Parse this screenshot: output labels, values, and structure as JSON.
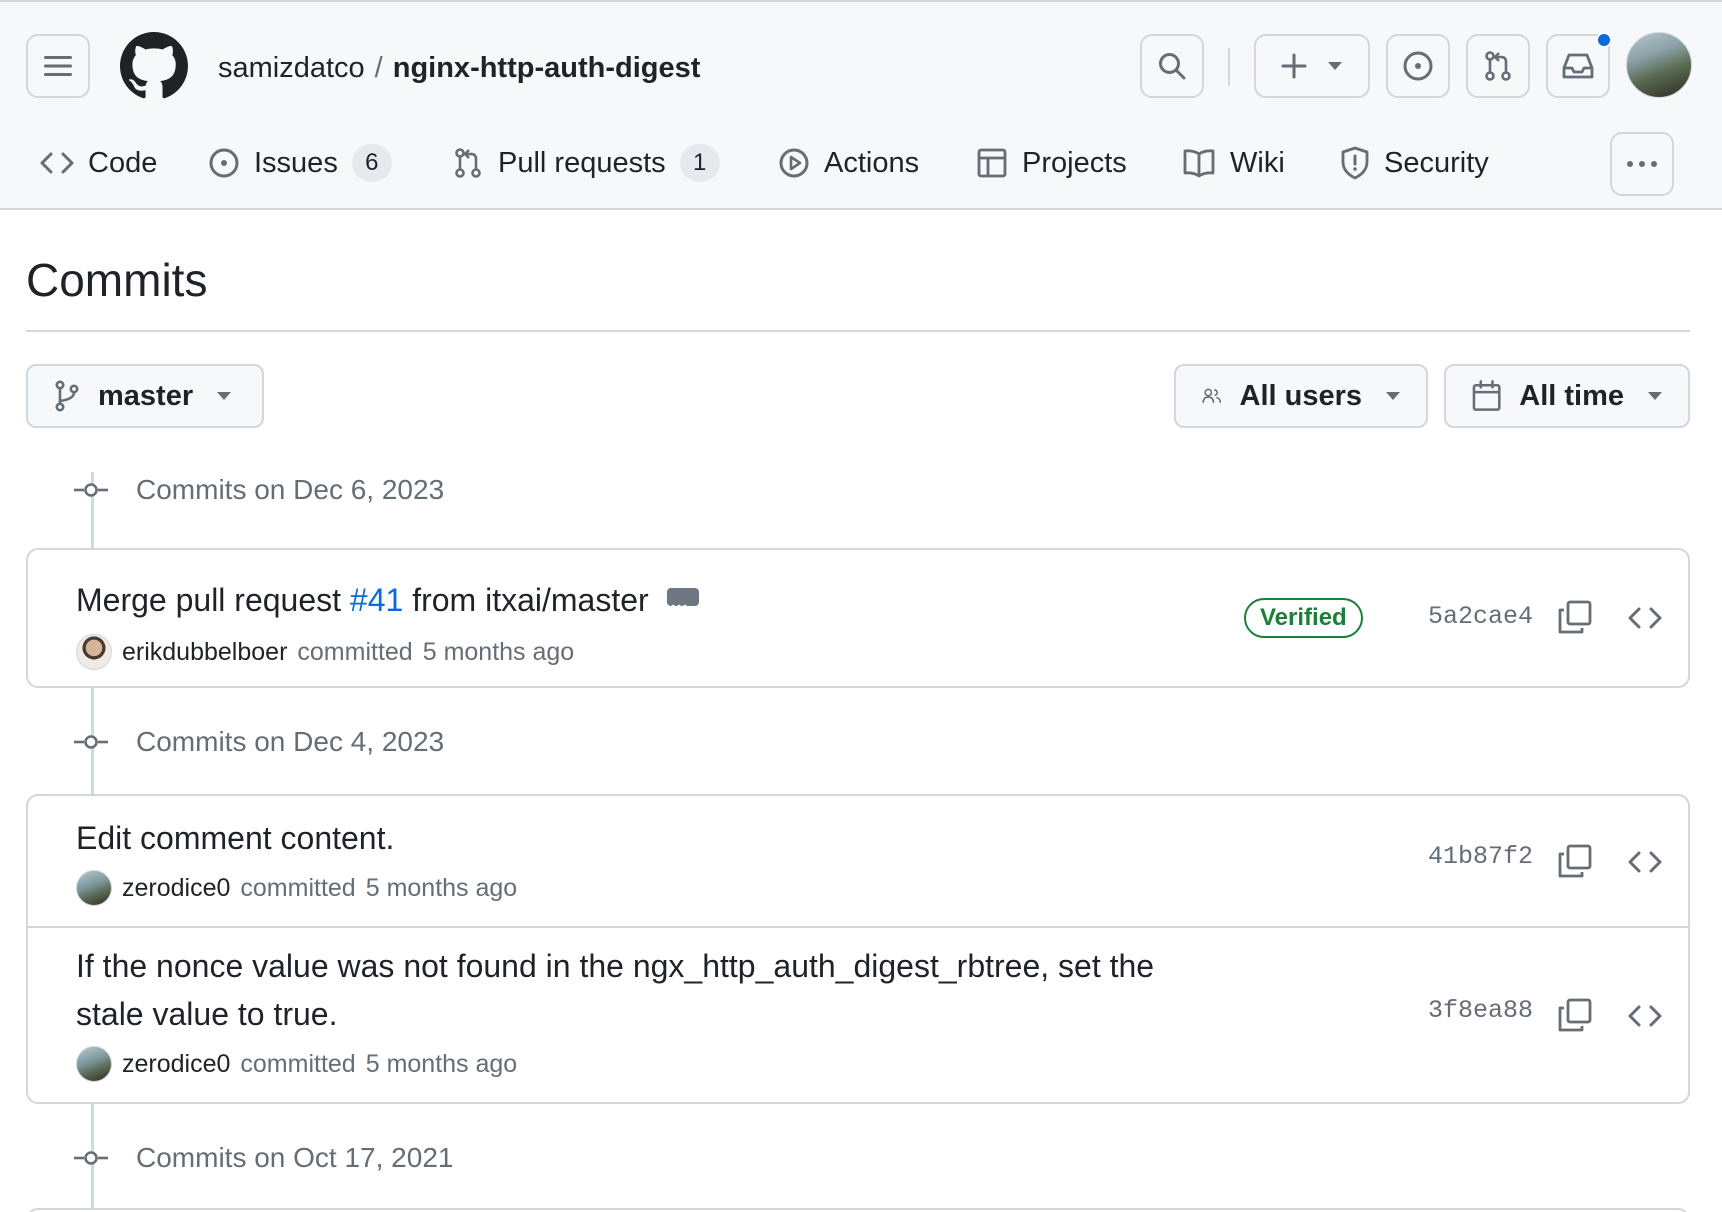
{
  "header": {
    "owner": "samizdatco",
    "separator": "/",
    "repo": "nginx-http-auth-digest"
  },
  "tabs": [
    {
      "label": "Code"
    },
    {
      "label": "Issues",
      "count": "6"
    },
    {
      "label": "Pull requests",
      "count": "1"
    },
    {
      "label": "Actions"
    },
    {
      "label": "Projects"
    },
    {
      "label": "Wiki"
    },
    {
      "label": "Security"
    }
  ],
  "page": {
    "title": "Commits"
  },
  "filters": {
    "branch": "master",
    "users": "All users",
    "time": "All time"
  },
  "groups": [
    {
      "heading": "Commits on Dec 6, 2023",
      "commits": [
        {
          "message_prefix": "Merge pull request ",
          "pr_link": "#41",
          "message_suffix": " from itxai/master",
          "author": "erikdubbelboer",
          "action": "committed",
          "time": "5 months ago",
          "badge": "Verified",
          "sha": "5a2cae4"
        }
      ]
    },
    {
      "heading": "Commits on Dec 4, 2023",
      "commits": [
        {
          "message": "Edit comment content.",
          "author": "zerodice0",
          "action": "committed",
          "time": "5 months ago",
          "sha": "41b87f2"
        },
        {
          "message_line1": "If the nonce value was not found in the ngx_http_auth_digest_rbtree, set the",
          "message_line2": "stale value to true.",
          "author": "zerodice0",
          "action": "committed",
          "time": "5 months ago",
          "sha": "3f8ea88"
        }
      ]
    },
    {
      "heading": "Commits on Oct 17, 2021"
    }
  ],
  "colors": {
    "accent": "#0969da",
    "verified": "#1a7f37",
    "muted": "#656d76",
    "border": "#d0d7de",
    "header_bg": "#f6f8fa"
  }
}
